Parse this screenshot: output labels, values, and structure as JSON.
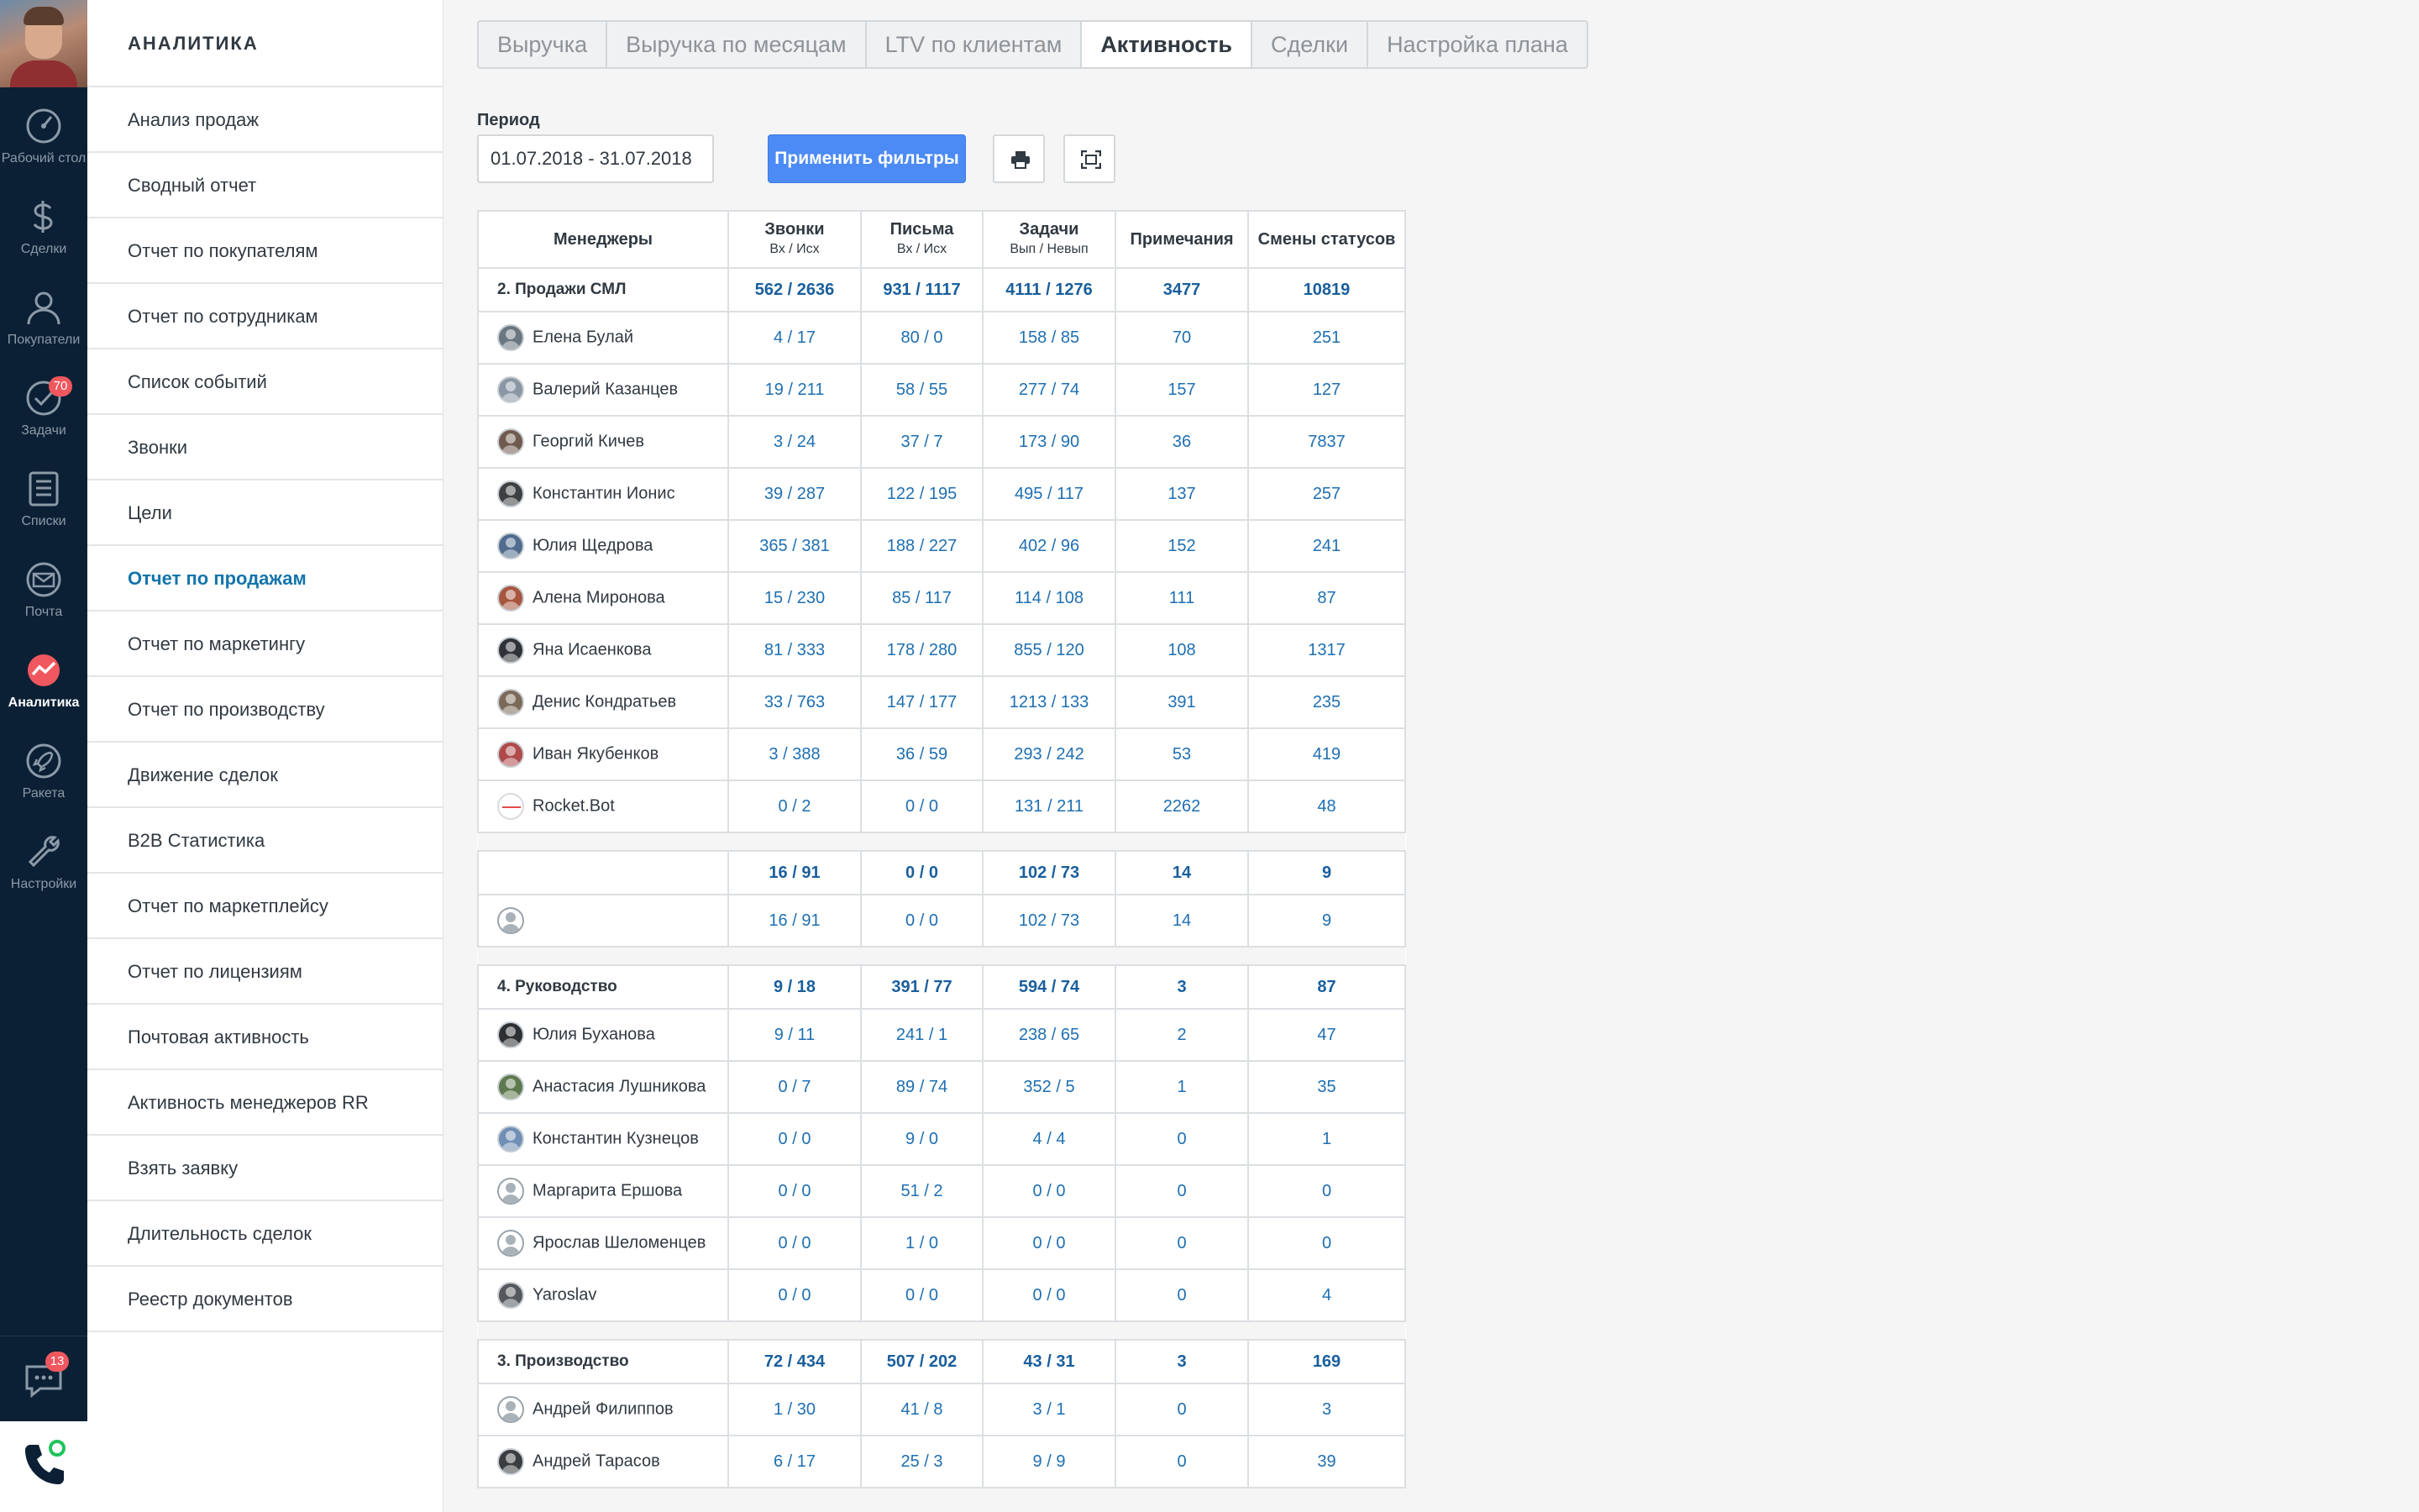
{
  "nav": {
    "items": [
      {
        "id": "desk",
        "label": "Рабочий стол",
        "icon": "dashboard-icon"
      },
      {
        "id": "deals",
        "label": "Сделки",
        "icon": "dollar-icon"
      },
      {
        "id": "customers",
        "label": "Покупатели",
        "icon": "user-icon"
      },
      {
        "id": "tasks",
        "label": "Задачи",
        "icon": "check-icon",
        "badge": "70"
      },
      {
        "id": "lists",
        "label": "Списки",
        "icon": "list-icon"
      },
      {
        "id": "mail",
        "label": "Почта",
        "icon": "mail-icon"
      },
      {
        "id": "analytics",
        "label": "Аналитика",
        "icon": "analytics-icon",
        "active": true
      },
      {
        "id": "rocket",
        "label": "Ракета",
        "icon": "rocket-icon"
      },
      {
        "id": "settings",
        "label": "Настройки",
        "icon": "wrench-icon"
      }
    ],
    "chat_badge": "13"
  },
  "submenu": {
    "title": "АНАЛИТИКА",
    "items": [
      "Анализ продаж",
      "Сводный отчет",
      "Отчет по покупателям",
      "Отчет по сотрудникам",
      "Список событий",
      "Звонки",
      "Цели",
      "Отчет по продажам",
      "Отчет по маркетингу",
      "Отчет по производству",
      "Движение сделок",
      "B2B Статистика",
      "Отчет по маркетплейсу",
      "Отчет по лицензиям",
      "Почтовая активность",
      "Активность менеджеров RR",
      "Взять заявку",
      "Длительность сделок",
      "Реестр документов"
    ],
    "active_index": 7
  },
  "tabs": [
    "Выручка",
    "Выручка по месяцам",
    "LTV по клиентам",
    "Активность",
    "Сделки",
    "Настройка плана"
  ],
  "active_tab": 3,
  "filters": {
    "period_label": "Период",
    "period_value": "01.07.2018 - 31.07.2018",
    "apply_label": "Применить фильтры"
  },
  "table": {
    "headers": {
      "managers": "Менеджеры",
      "calls": "Звонки",
      "calls_sub": "Вх / Исх",
      "letters": "Письма",
      "letters_sub": "Вх / Исх",
      "tasks": "Задачи",
      "tasks_sub": "Вып / Невып",
      "notes": "Примечания",
      "statuses": "Смены статусов"
    },
    "groups": [
      {
        "name": "2. Продажи СМЛ",
        "totals": [
          "562 / 2636",
          "931 / 1117",
          "4111 / 1276",
          "3477",
          "10819"
        ],
        "rows": [
          {
            "name": "Елена Булай",
            "av": "#6b7780",
            "vals": [
              "4 / 17",
              "80 / 0",
              "158 / 85",
              "70",
              "251"
            ]
          },
          {
            "name": "Валерий Казанцев",
            "av": "#8a96a3",
            "vals": [
              "19 / 211",
              "58 / 55",
              "277 / 74",
              "157",
              "127"
            ]
          },
          {
            "name": "Георгий Кичев",
            "av": "#6f5a4d",
            "vals": [
              "3 / 24",
              "37 / 7",
              "173 / 90",
              "36",
              "7837"
            ]
          },
          {
            "name": "Константин Ионис",
            "av": "#3d3f42",
            "vals": [
              "39 / 287",
              "122 / 195",
              "495 / 117",
              "137",
              "257"
            ]
          },
          {
            "name": "Юлия Щедрова",
            "av": "#4f6c8f",
            "vals": [
              "365 / 381",
              "188 / 227",
              "402 / 96",
              "152",
              "241"
            ]
          },
          {
            "name": "Алена Миронова",
            "av": "#a8553f",
            "vals": [
              "15 / 230",
              "85 / 117",
              "114 / 108",
              "111",
              "87"
            ]
          },
          {
            "name": "Яна Исаенкова",
            "av": "#2f3236",
            "vals": [
              "81 / 333",
              "178 / 280",
              "855 / 120",
              "108",
              "1317"
            ]
          },
          {
            "name": "Денис Кондратьев",
            "av": "#7b6a58",
            "vals": [
              "33 / 763",
              "147 / 177",
              "1213 / 133",
              "391",
              "235"
            ]
          },
          {
            "name": "Иван Якубенков",
            "av": "#b04a4a",
            "vals": [
              "3 / 388",
              "36 / 59",
              "293 / 242",
              "53",
              "419"
            ]
          },
          {
            "name": "Rocket.Bot",
            "av": "bot",
            "vals": [
              "0 / 2",
              "0 / 0",
              "131 / 211",
              "2262",
              "48"
            ]
          }
        ]
      },
      {
        "name": "",
        "totals": [
          "16 / 91",
          "0 / 0",
          "102 / 73",
          "14",
          "9"
        ],
        "rows": [
          {
            "name": "",
            "av": "blank",
            "vals": [
              "16 / 91",
              "0 / 0",
              "102 / 73",
              "14",
              "9"
            ]
          }
        ]
      },
      {
        "name": "4. Руководство",
        "totals": [
          "9 / 18",
          "391 / 77",
          "594 / 74",
          "3",
          "87"
        ],
        "rows": [
          {
            "name": "Юлия Буханова",
            "av": "#2d3033",
            "vals": [
              "9 / 11",
              "241 / 1",
              "238 / 65",
              "2",
              "47"
            ]
          },
          {
            "name": "Анастасия Лушникова",
            "av": "#5d7a4e",
            "vals": [
              "0 / 7",
              "89 / 74",
              "352 / 5",
              "1",
              "35"
            ]
          },
          {
            "name": "Константин Кузнецов",
            "av": "#6f8fb5",
            "vals": [
              "0 / 0",
              "9 / 0",
              "4 / 4",
              "0",
              "1"
            ]
          },
          {
            "name": "Маргарита Ершова",
            "av": "blank",
            "vals": [
              "0 / 0",
              "51 / 2",
              "0 / 0",
              "0",
              "0"
            ]
          },
          {
            "name": "Ярослав Шеломенцев",
            "av": "blank",
            "vals": [
              "0 / 0",
              "1 / 0",
              "0 / 0",
              "0",
              "0"
            ]
          },
          {
            "name": "Yaroslav",
            "av": "#55595e",
            "vals": [
              "0 / 0",
              "0 / 0",
              "0 / 0",
              "0",
              "4"
            ]
          }
        ]
      },
      {
        "name": "3. Производство",
        "totals": [
          "72 / 434",
          "507 / 202",
          "43 / 31",
          "3",
          "169"
        ],
        "rows": [
          {
            "name": "Андрей Филиппов",
            "av": "blank",
            "vals": [
              "1 / 30",
              "41 / 8",
              "3 / 1",
              "0",
              "3"
            ]
          },
          {
            "name": "Андрей Тарасов",
            "av": "#3a3d40",
            "vals": [
              "6 / 17",
              "25 / 3",
              "9 / 9",
              "0",
              "39"
            ]
          }
        ]
      }
    ]
  },
  "colors": {
    "nav_bg": "#0b2035",
    "link_blue": "#1e6fb2",
    "apply_blue": "#4c8bf5",
    "badge_red": "#f0575e"
  }
}
